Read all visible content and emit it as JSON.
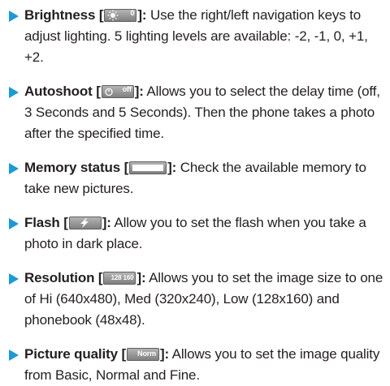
{
  "items": [
    {
      "label": "Brightness",
      "bracket_open": "[",
      "bracket_close": "]:",
      "icon": "brightness-icon",
      "icon_text": "0",
      "description": "Use the right/left navigation keys to adjust lighting. 5 lighting levels are available: -2, -1, 0, +1, +2."
    },
    {
      "label": "Autoshoot",
      "bracket_open": "[",
      "bracket_close": "]:",
      "icon": "autoshoot-icon",
      "icon_text": "off",
      "description": "Allows you to select the delay time (off, 3 Seconds and 5 Seconds). Then the phone takes a photo after the specified time."
    },
    {
      "label": "Memory status",
      "bracket_open": "[",
      "bracket_close": "]:",
      "icon": "memory-bar-icon",
      "icon_text": "",
      "description": "Check the available memory to take new pictures."
    },
    {
      "label": "Flash",
      "bracket_open": "[",
      "bracket_close": "]:",
      "icon": "flash-icon",
      "icon_text": "",
      "description": "Allow you to set the flash when you take a photo in dark place."
    },
    {
      "label": "Resolution",
      "bracket_open": "[",
      "bracket_close": "]:",
      "icon": "resolution-icon",
      "icon_text": "128 160",
      "description": "Allows you to set the image size to one of Hi (640x480), Med (320x240), Low (128x160) and phonebook (48x48)."
    },
    {
      "label": "Picture quality",
      "bracket_open": "[",
      "bracket_close": "]:",
      "icon": "quality-icon",
      "icon_text": "Norm",
      "description": "Allows you to set the image quality from Basic, Normal and Fine."
    }
  ],
  "colors": {
    "bullet": "#1a9ad6",
    "text": "#231f20",
    "icon_bg": "#8e8e8e"
  }
}
